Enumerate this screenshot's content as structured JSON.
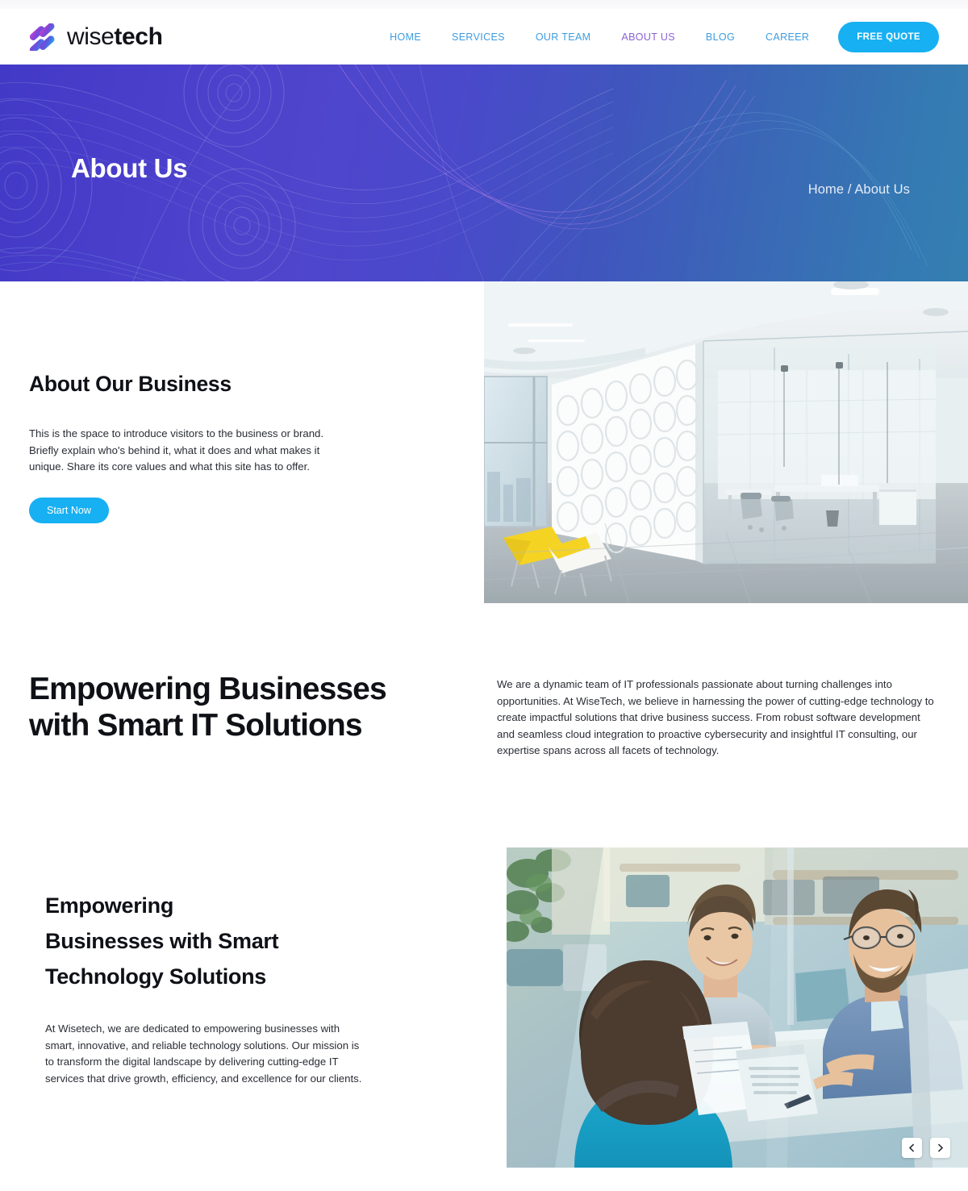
{
  "brand": {
    "name_light": "wise",
    "name_bold": "tech",
    "logo_icon": "wisetech-logo-icon"
  },
  "nav": {
    "items": [
      {
        "label": "HOME",
        "active": false
      },
      {
        "label": "SERVICES",
        "active": false
      },
      {
        "label": "OUR TEAM",
        "active": false
      },
      {
        "label": "ABOUT US",
        "active": true
      },
      {
        "label": "BLOG",
        "active": false
      },
      {
        "label": "CAREER",
        "active": false
      }
    ],
    "cta_label": "FREE QUOTE",
    "link_color": "#3d9de0",
    "active_color": "#8b63d6",
    "cta_color": "#17b0f2"
  },
  "hero": {
    "title": "About Us",
    "breadcrumb": "Home / About Us",
    "breadcrumb_home": "Home",
    "breadcrumb_separator": "/",
    "breadcrumb_current": "About Us",
    "gradient_start": "#4239c6",
    "gradient_end": "#337fb2"
  },
  "about_business": {
    "heading": "About Our Business",
    "paragraph": "This is the space to introduce visitors to the business or brand. Briefly explain who's behind it, what it does and what makes it unique. Share its core values and what this site has to offer.",
    "button_label": "Start Now",
    "button_color": "#17b0f2",
    "image_alt": "modern-office-interior-photo"
  },
  "empowering": {
    "heading_line1": "Empowering Businesses",
    "heading_line2": "with Smart IT Solutions",
    "paragraph": "We are a dynamic team of IT professionals passionate about turning challenges into opportunities. At WiseTech, we believe in harnessing the power of cutting-edge technology to create impactful solutions that drive business success. From robust software development and seamless cloud integration to proactive cybersecurity and insightful IT consulting, our expertise spans across all facets of technology."
  },
  "technology": {
    "heading_line1": "Empowering",
    "heading_line2": "Businesses with Smart",
    "heading_line3": "Technology Solutions",
    "paragraph": "At Wisetech, we are dedicated to empowering businesses with smart, innovative, and reliable technology solutions. Our mission is to transform the digital landscape by delivering cutting-edge IT services that drive growth, efficiency, and excellence for our clients.",
    "image_alt": "team-meeting-photo",
    "carousel": {
      "prev_icon": "chevron-left-icon",
      "next_icon": "chevron-right-icon"
    }
  }
}
